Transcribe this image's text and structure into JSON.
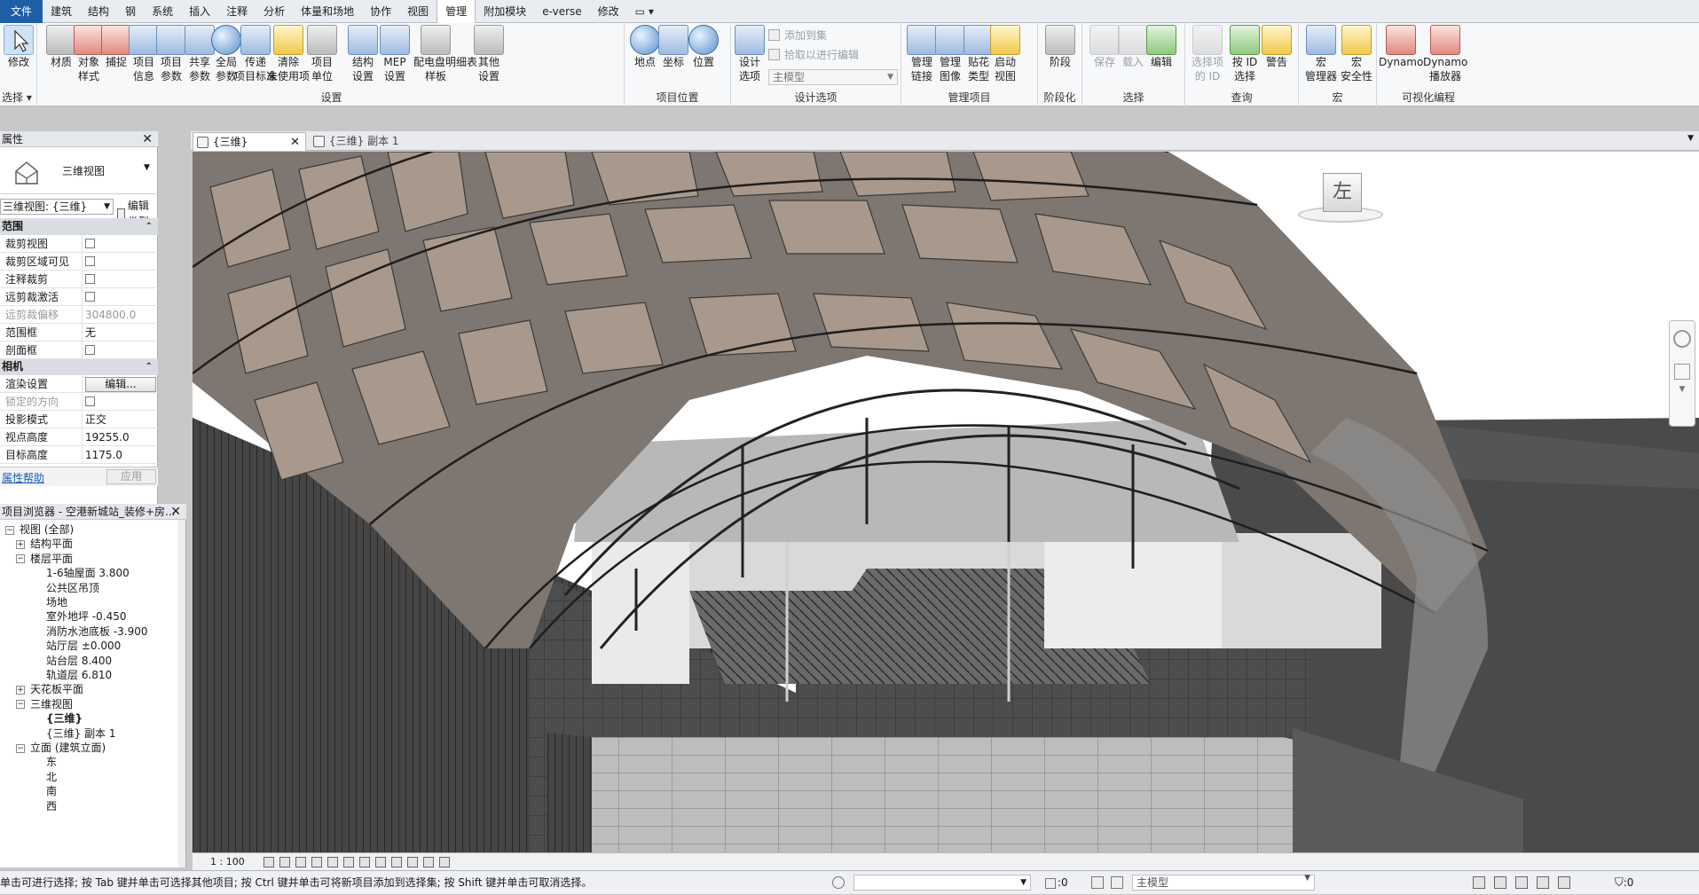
{
  "menubar": {
    "items": [
      "文件",
      "建筑",
      "结构",
      "钢",
      "系统",
      "插入",
      "注释",
      "分析",
      "体量和场地",
      "协作",
      "视图",
      "管理",
      "附加模块",
      "e-verse",
      "修改"
    ],
    "active": "管理"
  },
  "ribbon": {
    "select": {
      "label": "修改",
      "group": "选择"
    },
    "settings": {
      "tools": [
        "材质",
        "对象\n样式",
        "捕捉",
        "项目\n信息",
        "项目\n参数",
        "共享\n参数",
        "全局\n参数",
        "传递\n项目标准",
        "清除\n未使用项",
        "项目\n单位",
        "结构\n设置",
        "MEP\n设置",
        "配电盘明细表\n样板",
        "其他\n设置"
      ],
      "group": "设置"
    },
    "location": {
      "tools": [
        "地点",
        "坐标",
        "位置"
      ],
      "group": "项目位置"
    },
    "design_options": {
      "tools": [
        "设计\n选项"
      ],
      "small": [
        "添加到集",
        "拾取以进行编辑"
      ],
      "dropdown": "主模型",
      "group": "设计选项"
    },
    "manage_project": {
      "tools": [
        "管理\n链接",
        "管理\n图像",
        "贴花\n类型",
        "启动\n视图"
      ],
      "group": "管理项目"
    },
    "phasing": {
      "tools": [
        "阶段"
      ],
      "group": "阶段化"
    },
    "selection": {
      "tools": [
        "保存",
        "载入",
        "编辑"
      ],
      "group": "选择"
    },
    "inquiry": {
      "tools": [
        "选择项\n的 ID",
        "按 ID\n选择",
        "警告"
      ],
      "group": "查询"
    },
    "macros": {
      "tools": [
        "宏\n管理器",
        "宏\n安全性"
      ],
      "group": "宏"
    },
    "visual_programming": {
      "tools": [
        "Dynamo",
        "Dynamo\n播放器"
      ],
      "group": "可视化编程"
    }
  },
  "properties": {
    "title": "属性",
    "type_name": "三维视图",
    "instance_select": "三维视图: {三维}",
    "edit_type": "编辑类型",
    "sections": {
      "extents": "范围",
      "camera": "相机"
    },
    "rows_extents": [
      {
        "k": "裁剪视图",
        "v": "",
        "check": true,
        "dis": false
      },
      {
        "k": "裁剪区域可见",
        "v": "",
        "check": true,
        "dis": false
      },
      {
        "k": "注释裁剪",
        "v": "",
        "check": true,
        "dis": false
      },
      {
        "k": "远剪裁激活",
        "v": "",
        "check": true,
        "dis": false
      },
      {
        "k": "远剪裁偏移",
        "v": "304800.0",
        "check": false,
        "dis": true
      },
      {
        "k": "范围框",
        "v": "无",
        "check": false,
        "dis": false
      },
      {
        "k": "剖面框",
        "v": "",
        "check": true,
        "dis": false
      }
    ],
    "rows_camera": [
      {
        "k": "渲染设置",
        "v": "编辑...",
        "button": true,
        "dis": false
      },
      {
        "k": "锁定的方向",
        "v": "",
        "check": true,
        "dis": true
      },
      {
        "k": "投影模式",
        "v": "正交",
        "dis": false
      },
      {
        "k": "视点高度",
        "v": "19255.0",
        "dis": false
      },
      {
        "k": "目标高度",
        "v": "1175.0",
        "dis": false
      }
    ],
    "help": "属性帮助",
    "apply": "应用"
  },
  "browser": {
    "title": "项目浏览器 - 空港新城站_装修+房...",
    "items": [
      {
        "label": "视图 (全部)",
        "level": 0,
        "toggle": "−"
      },
      {
        "label": "结构平面",
        "level": 1,
        "toggle": "+"
      },
      {
        "label": "楼层平面",
        "level": 1,
        "toggle": "−"
      },
      {
        "label": "1-6轴屋面 3.800",
        "level": 2
      },
      {
        "label": "公共区吊顶",
        "level": 2
      },
      {
        "label": "场地",
        "level": 2
      },
      {
        "label": "室外地坪 -0.450",
        "level": 2
      },
      {
        "label": "消防水池底板 -3.900",
        "level": 2
      },
      {
        "label": "站厅层 ±0.000",
        "level": 2
      },
      {
        "label": "站台层 8.400",
        "level": 2
      },
      {
        "label": "轨道层 6.810",
        "level": 2
      },
      {
        "label": "天花板平面",
        "level": 1,
        "toggle": "+"
      },
      {
        "label": "三维视图",
        "level": 1,
        "toggle": "−"
      },
      {
        "label": "{三维}",
        "level": 2,
        "bold": true
      },
      {
        "label": "{三维} 副本 1",
        "level": 2
      },
      {
        "label": "立面 (建筑立面)",
        "level": 1,
        "toggle": "−"
      },
      {
        "label": "东",
        "level": 2
      },
      {
        "label": "北",
        "level": 2
      },
      {
        "label": "南",
        "level": 2
      },
      {
        "label": "西",
        "level": 2
      }
    ]
  },
  "view_tabs": [
    {
      "label": "{三维}",
      "active": true
    },
    {
      "label": "{三维} 副本 1",
      "active": false
    }
  ],
  "viewcube_face": "左",
  "view_scale": "1 : 100",
  "status": {
    "message": "单击可进行选择; 按 Tab 键并单击可选择其他项目; 按 Ctrl 键并单击可将新项目添加到选择集; 按 Shift 键并单击可取消选择。",
    "select_count": ":0",
    "model": "主模型",
    "filter_count": ":0"
  }
}
